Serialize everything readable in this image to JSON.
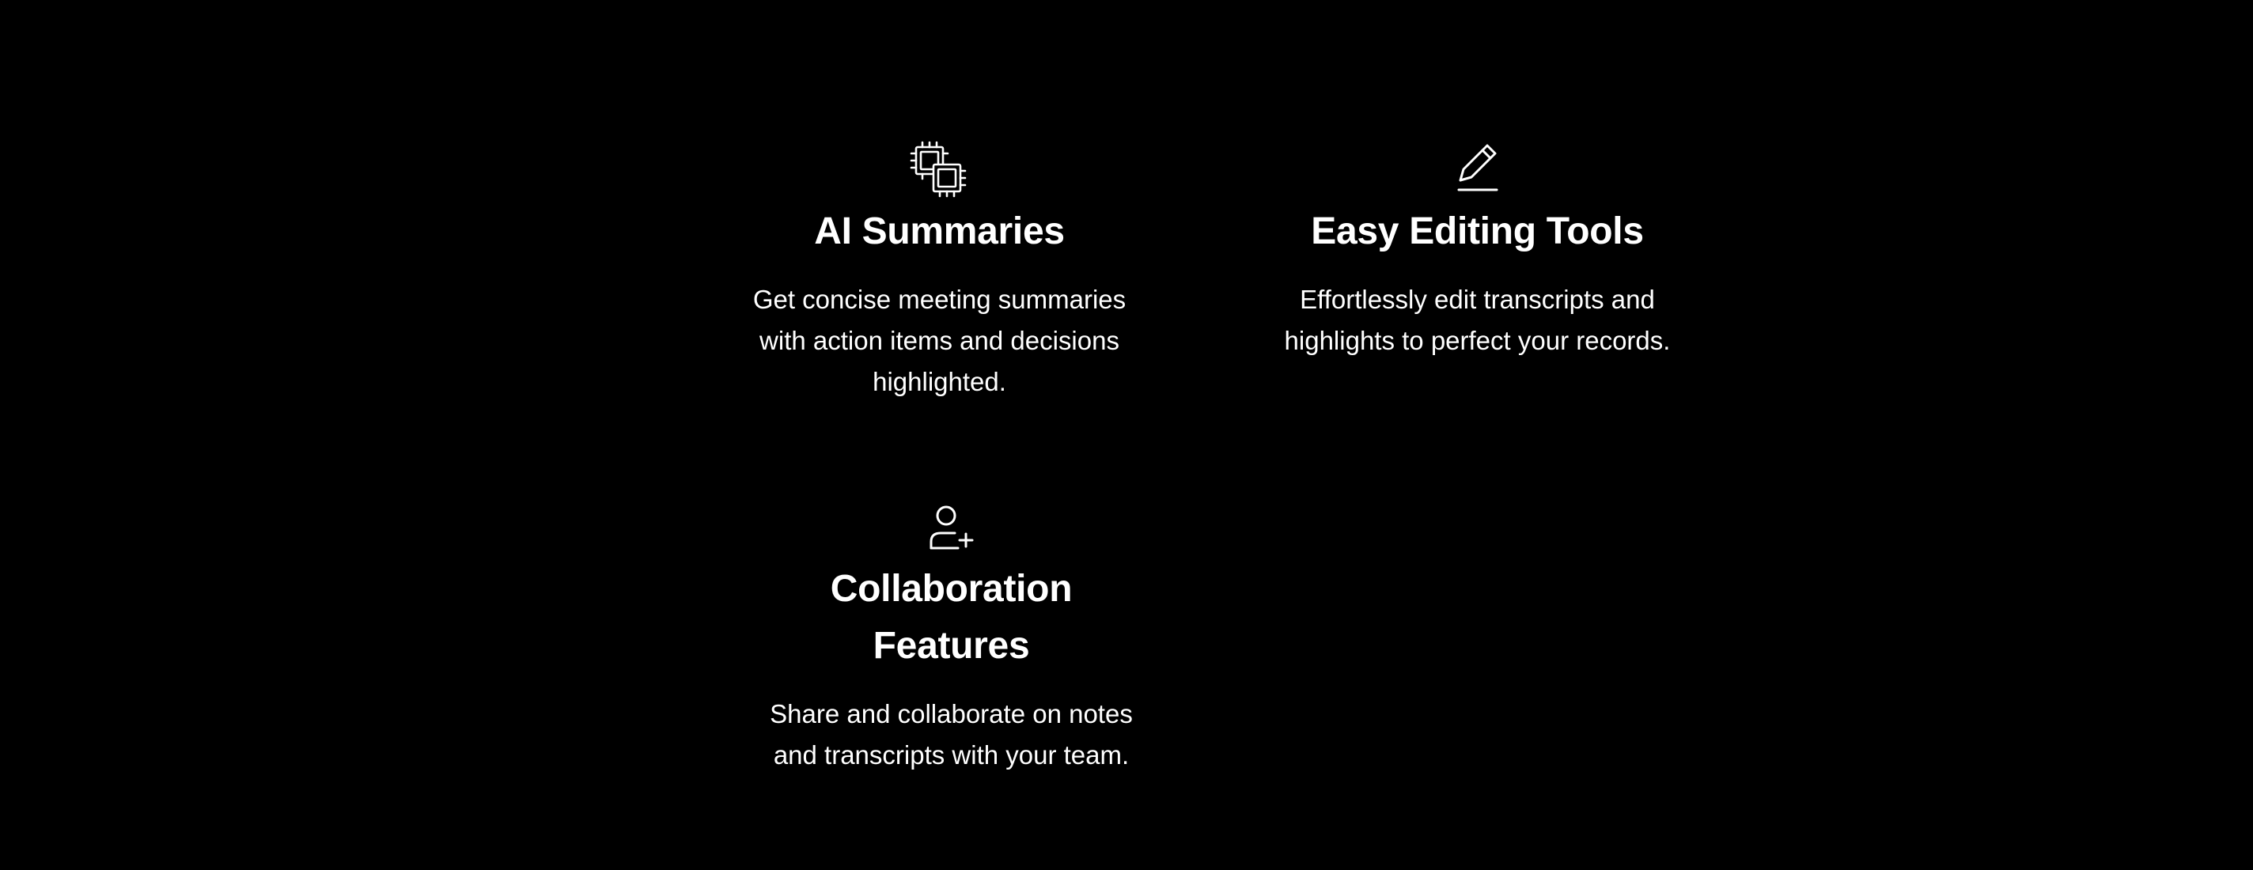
{
  "features": [
    {
      "icon": "chip-icon",
      "title": "AI Summaries",
      "description": "Get concise meeting summaries with action items and decisions highlighted."
    },
    {
      "icon": "pencil-edit-icon",
      "title": "Easy Editing Tools",
      "description": "Effortlessly edit transcripts and highlights to perfect your records."
    },
    {
      "icon": "user-add-icon",
      "title": "Collaboration Features",
      "description": "Share and collaborate on notes and transcripts with your team."
    }
  ],
  "colors": {
    "background": "#000000",
    "text": "#ffffff"
  }
}
